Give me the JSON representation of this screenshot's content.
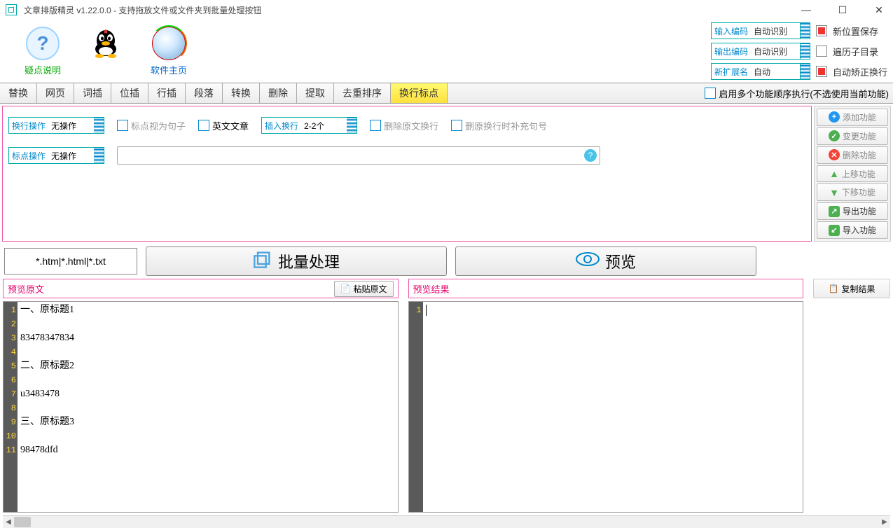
{
  "title": "文章排版精灵 v1.22.0.0 - 支持拖放文件或文件夹到批量处理按钮",
  "topicons": {
    "help": "疑点说明",
    "home": "软件主页"
  },
  "encoding": {
    "in_label": "输入编码",
    "in_val": "自动识别",
    "out_label": "输出编码",
    "out_val": "自动识别",
    "ext_label": "新扩展名",
    "ext_val": "自动",
    "opts": [
      "新位置保存",
      "遍历子目录",
      "自动矫正换行"
    ]
  },
  "tabs": [
    "替换",
    "网页",
    "词插",
    "位插",
    "行插",
    "段落",
    "转换",
    "删除",
    "提取",
    "去重排序",
    "换行标点"
  ],
  "active_tab": 10,
  "tabright": "启用多个功能顺序执行(不选使用当前功能)",
  "ctrl": {
    "row1": {
      "op_label": "换行操作",
      "op_val": "无操作",
      "cb1": "标点视为句子",
      "cb2": "英文文章",
      "ins_label": "插入换行",
      "ins_val": "2-2个",
      "cb3": "删除原文换行",
      "cb4": "删原换行时补充句号"
    },
    "row2": {
      "op_label": "标点操作",
      "op_val": "无操作"
    }
  },
  "fn": [
    "添加功能",
    "变更功能",
    "删除功能",
    "上移功能",
    "下移功能",
    "导出功能",
    "导入功能"
  ],
  "fileext": "*.htm|*.html|*.txt",
  "batch": "批量处理",
  "preview": "预览",
  "hdr": {
    "left": "预览原文",
    "paste": "粘贴原文",
    "right": "预览结果",
    "copy": "复制结果"
  },
  "source_lines": [
    "一、原标题1",
    "",
    "83478347834",
    "",
    "二、原标题2",
    "",
    "u3483478",
    "",
    "三、原标题3",
    "",
    "98478dfd"
  ]
}
